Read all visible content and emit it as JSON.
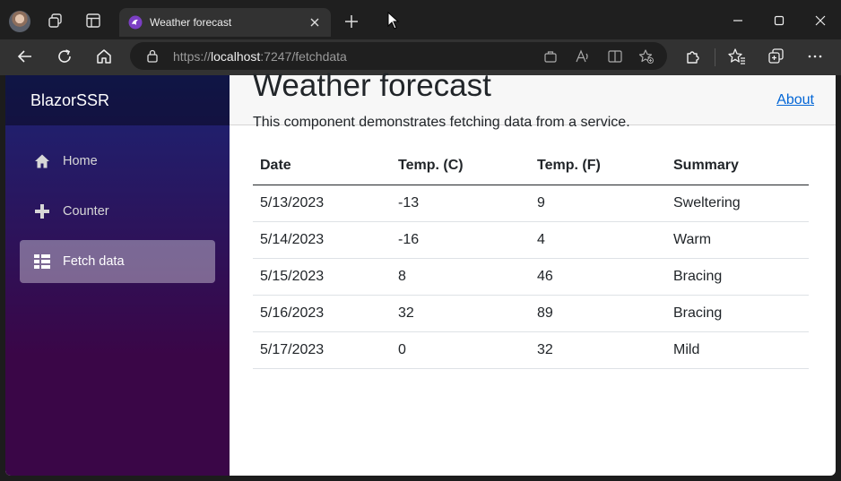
{
  "browser": {
    "tab_title": "Weather forecast",
    "url_scheme": "https://",
    "url_host": "localhost",
    "url_rest": ":7247/fetchdata"
  },
  "app": {
    "brand": "BlazorSSR",
    "about_link": "About"
  },
  "nav": {
    "items": [
      {
        "label": "Home",
        "icon": "home-icon"
      },
      {
        "label": "Counter",
        "icon": "plus-icon"
      },
      {
        "label": "Fetch data",
        "icon": "list-icon",
        "active": true
      }
    ]
  },
  "page": {
    "title": "Weather forecast",
    "description": "This component demonstrates fetching data from a service."
  },
  "table": {
    "headers": [
      "Date",
      "Temp. (C)",
      "Temp. (F)",
      "Summary"
    ],
    "rows": [
      [
        "5/13/2023",
        "-13",
        "9",
        "Sweltering"
      ],
      [
        "5/14/2023",
        "-16",
        "4",
        "Warm"
      ],
      [
        "5/15/2023",
        "8",
        "46",
        "Bracing"
      ],
      [
        "5/16/2023",
        "32",
        "89",
        "Bracing"
      ],
      [
        "5/17/2023",
        "0",
        "32",
        "Mild"
      ]
    ]
  },
  "colors": {
    "link": "#0366d6",
    "sidebar_top": "#1b2474",
    "sidebar_bottom": "#3a0647"
  }
}
